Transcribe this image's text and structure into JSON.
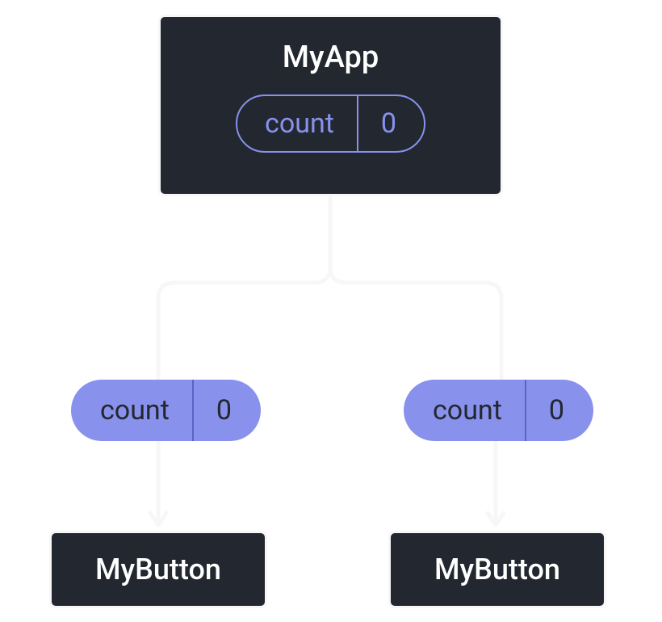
{
  "parent": {
    "name": "MyApp",
    "state": {
      "label": "count",
      "value": "0"
    }
  },
  "props": {
    "left": {
      "label": "count",
      "value": "0"
    },
    "right": {
      "label": "count",
      "value": "0"
    }
  },
  "children": {
    "left": {
      "name": "MyButton"
    },
    "right": {
      "name": "MyButton"
    }
  }
}
